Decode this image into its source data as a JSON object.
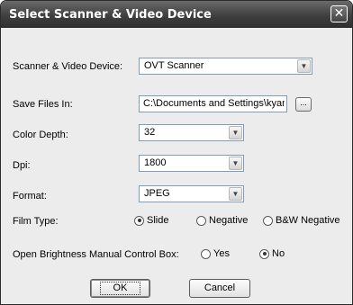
{
  "window": {
    "title": "Select Scanner & Video Device",
    "close_glyph": "✕"
  },
  "form": {
    "device": {
      "label": "Scanner & Video Device:",
      "value": "OVT Scanner"
    },
    "save": {
      "label": "Save Files In:",
      "value": "C:\\Documents and Settings\\kyama",
      "browse_label": "..."
    },
    "color_depth": {
      "label": "Color Depth:",
      "value": "32"
    },
    "dpi": {
      "label": "Dpi:",
      "value": "1800"
    },
    "format": {
      "label": "Format:",
      "value": "JPEG"
    },
    "film_type": {
      "label": "Film Type:",
      "options": [
        {
          "label": "Slide",
          "selected": true
        },
        {
          "label": "Negative",
          "selected": false
        },
        {
          "label": "B&W Negative",
          "selected": false
        }
      ]
    },
    "brightness": {
      "label": "Open Brightness Manual Control Box:",
      "options": [
        {
          "label": "Yes",
          "selected": false
        },
        {
          "label": "No",
          "selected": true
        }
      ]
    }
  },
  "buttons": {
    "ok": "OK",
    "cancel": "Cancel"
  },
  "icons": {
    "dropdown_arrow": "chevron-down-icon",
    "close": "close-icon"
  }
}
